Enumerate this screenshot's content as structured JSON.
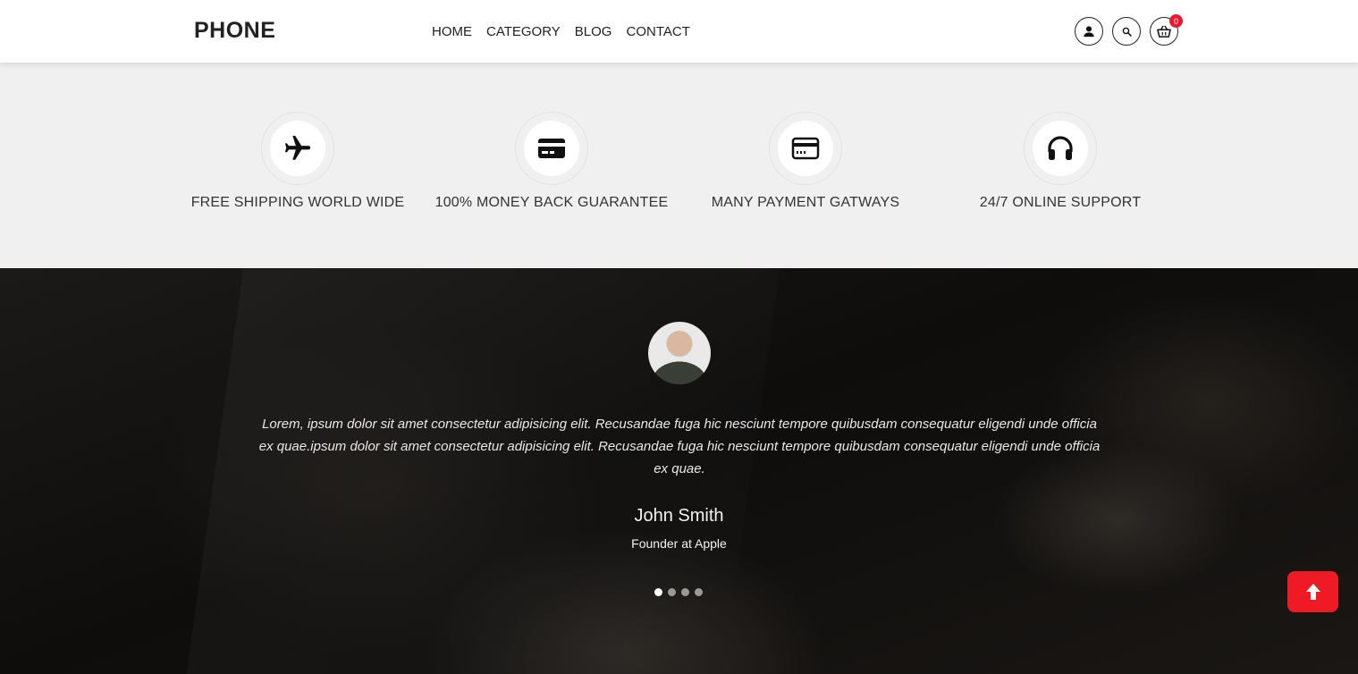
{
  "header": {
    "logo": "PHONE",
    "nav": [
      "HOME",
      "CATEGORY",
      "BLOG",
      "CONTACT"
    ],
    "cart_count": "0",
    "icons": [
      "user-icon",
      "search-icon",
      "cart-icon"
    ]
  },
  "features": [
    {
      "icon": "airplane-icon",
      "label": "FREE SHIPPING WORLD WIDE"
    },
    {
      "icon": "credit-card-icon",
      "label": "100% MONEY BACK GUARANTEE"
    },
    {
      "icon": "payment-card-icon",
      "label": "MANY PAYMENT GATWAYS"
    },
    {
      "icon": "headphones-icon",
      "label": "24/7 ONLINE SUPPORT"
    }
  ],
  "testimonial": {
    "quote": "Lorem, ipsum dolor sit amet consectetur adipisicing elit. Recusandae fuga hic nesciunt tempore quibusdam consequatur eligendi unde officia ex quae.ipsum dolor sit amet consectetur adipisicing elit. Recusandae fuga hic nesciunt tempore quibusdam consequatur eligendi unde officia ex quae.",
    "name": "John Smith",
    "role": "Founder at Apple",
    "slides": 4,
    "active_slide": 1
  },
  "colors": {
    "accent": "#ee1b24",
    "badge": "#e8192c",
    "features_bg": "#f0f0f0"
  }
}
